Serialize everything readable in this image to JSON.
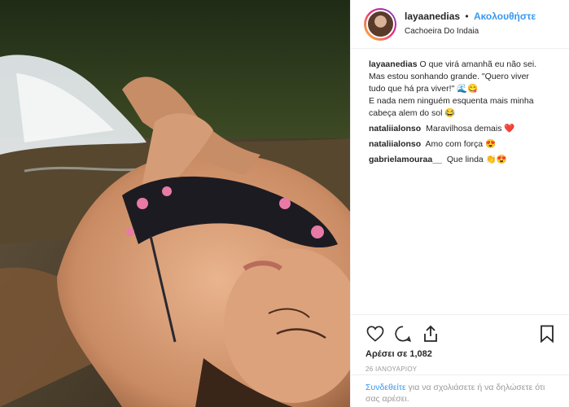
{
  "post": {
    "author": "layaanedias",
    "separator": "•",
    "follow_label": "Ακολουθήστε",
    "location": "Cachoeira Do Indaia"
  },
  "caption": {
    "user": "layaanedias",
    "lines": [
      "O que virá amanhã eu não sei.",
      "Mas estou sonhando grande. \"Quero viver",
      "tudo que há pra viver!\" 🌊😋",
      "E nada nem ninguém esquenta mais minha",
      "cabeça alem do sol 😂"
    ]
  },
  "comments": [
    {
      "user": "nataliialonso",
      "text": "Maravilhosa demais ❤️"
    },
    {
      "user": "nataliialonso",
      "text": "Amo com força 😍"
    },
    {
      "user": "gabrielamouraa__",
      "text": "Que linda 👏😍"
    }
  ],
  "engagement": {
    "likes_label": "Αρέσει σε 1,082",
    "date": "26 ΙΑΝΟΥΑΡΙΟΥ"
  },
  "login_prompt": {
    "link": "Συνδεθείτε",
    "text": " για να σχολιάσετε ή να δηλώσετε ότι σας αρέσει."
  },
  "icons": {
    "like": "heart-icon",
    "comment": "comment-bubble-icon",
    "share": "share-icon",
    "save": "bookmark-icon"
  },
  "colors": {
    "link_blue": "#3897f0",
    "text": "#262626",
    "muted": "#999999",
    "border": "#efefef"
  }
}
